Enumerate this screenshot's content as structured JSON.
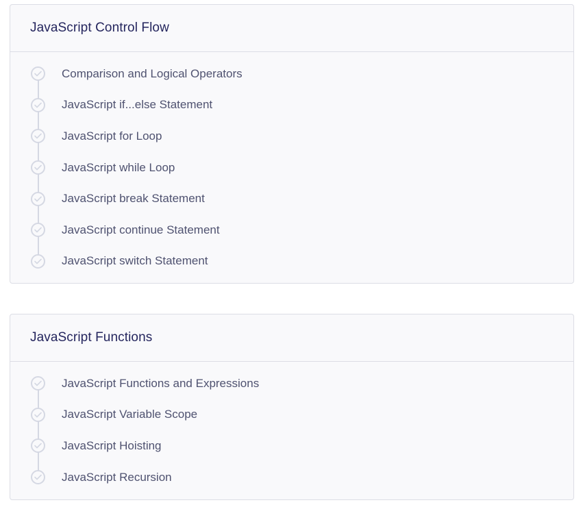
{
  "sections": [
    {
      "title": "JavaScript Control Flow",
      "items": [
        {
          "label": "Comparison and Logical Operators",
          "icon": "check-circle-icon"
        },
        {
          "label": "JavaScript if...else Statement",
          "icon": "check-circle-icon"
        },
        {
          "label": "JavaScript for Loop",
          "icon": "check-circle-icon"
        },
        {
          "label": "JavaScript while Loop",
          "icon": "check-circle-icon"
        },
        {
          "label": "JavaScript break Statement",
          "icon": "check-circle-icon"
        },
        {
          "label": "JavaScript continue Statement",
          "icon": "check-circle-icon"
        },
        {
          "label": "JavaScript switch Statement",
          "icon": "check-circle-icon"
        }
      ]
    },
    {
      "title": "JavaScript Functions",
      "items": [
        {
          "label": "JavaScript Functions and Expressions",
          "icon": "check-circle-icon"
        },
        {
          "label": "JavaScript Variable Scope",
          "icon": "check-circle-icon"
        },
        {
          "label": "JavaScript Hoisting",
          "icon": "check-circle-icon"
        },
        {
          "label": "JavaScript Recursion",
          "icon": "check-circle-icon"
        }
      ]
    }
  ],
  "colors": {
    "title": "#25265e",
    "item_text": "#4f5270",
    "border": "#dcdde5",
    "check": "#d5d8e3",
    "card_bg": "#f9f9fb"
  }
}
